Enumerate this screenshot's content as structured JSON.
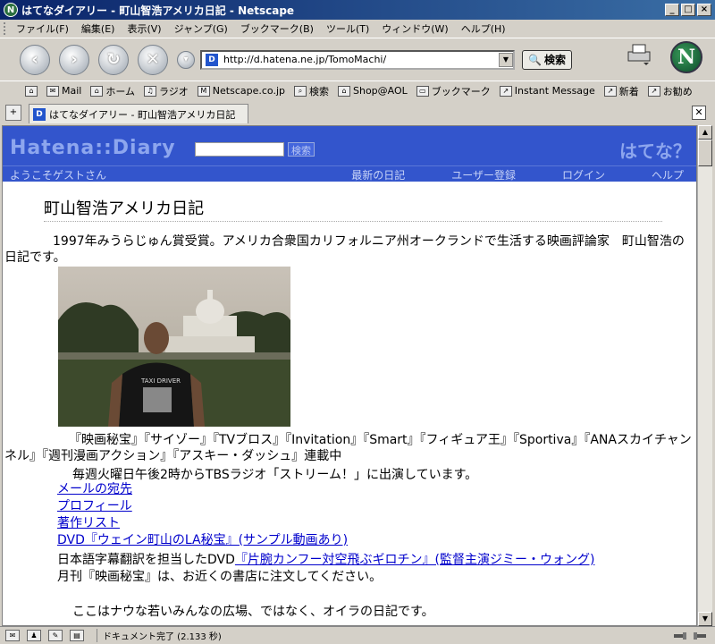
{
  "window": {
    "title": "はてなダイアリー - 町山智浩アメリカ日記 - Netscape",
    "app_icon": "N"
  },
  "menu": [
    "ファイル(F)",
    "編集(E)",
    "表示(V)",
    "ジャンプ(G)",
    "ブックマーク(B)",
    "ツール(T)",
    "ウィンドウ(W)",
    "ヘルプ(H)"
  ],
  "nav": {
    "url": "http://d.hatena.ne.jp/TomoMachi/",
    "url_favicon": "D",
    "search_label": "検索"
  },
  "personal_toolbar": [
    "Mail",
    "ホーム",
    "ラジオ",
    "Netscape.co.jp",
    "検索",
    "Shop@AOL",
    "ブックマーク",
    "Instant Message",
    "新着",
    "お勧め"
  ],
  "tab": {
    "favicon": "D",
    "label": "はてなダイアリー - 町山智浩アメリカ日記"
  },
  "hatena": {
    "logo": "Hatena::Diary",
    "search_button": "検索",
    "mark": "はてな？",
    "welcome": "ようこそゲストさん",
    "nav_links": [
      "最新の日記",
      "ユーザー登録",
      "ログイン",
      "ヘルプ"
    ]
  },
  "page": {
    "title": "町山智浩アメリカ日記",
    "intro": "1997年みうらじゅん賞受賞。アメリカ合衆国カリフォルニア州オークランドで生活する映画評論家　町山智浩の日記です。",
    "publications": "『映画秘宝』『サイゾー』『TVブロス』『Invitation』『Smart』『フィギュア王』『Sportiva』『ANAスカイチャンネル』『週刊漫画アクション』『アスキー・ダッシュ』連載中",
    "radio": "毎週火曜日午後2時からTBSラジオ「ストリーム！」に出演しています。",
    "links": [
      "メールの宛先",
      "プロフィール",
      "著作リスト",
      "DVD『ウェイン町山のLA秘宝』(サンプル動画あり)"
    ],
    "dvd_prefix": "日本語字幕翻訳を担当したDVD",
    "dvd_link": "『片腕カンフー対空飛ぶギロチン』(監督主演ジミー・ウォング)",
    "monthly": "月刊『映画秘宝』は、お近くの書店に注文してください。",
    "closing": "ここはナウな若いみんなの広場、ではなく、オイラの日記です。",
    "photo_shirt_text": "TAXI DRIVER"
  },
  "status": {
    "text": "ドキュメント完了 (2.133 秒)"
  },
  "colors": {
    "hatena_blue": "#3355cc",
    "link": "#0000cc",
    "title_bar": "#0a246a"
  }
}
